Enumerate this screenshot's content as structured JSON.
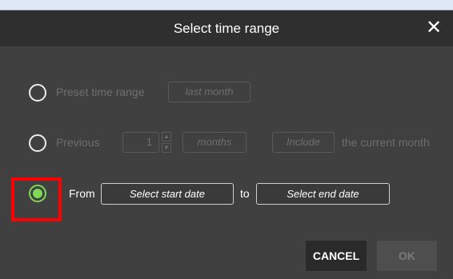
{
  "dialog": {
    "title": "Select time range",
    "close_symbol": "✕"
  },
  "options": {
    "preset": {
      "label": "Preset time range",
      "value": "last month"
    },
    "previous": {
      "label": "Previous",
      "count": "1",
      "unit": "months",
      "include": "Include",
      "suffix": "the current month"
    },
    "from": {
      "label": "From",
      "start_placeholder": "Select start date",
      "to_label": "to",
      "end_placeholder": "Select end date",
      "selected": true
    }
  },
  "buttons": {
    "cancel": "CANCEL",
    "ok": "OK"
  },
  "icons": {
    "close": "close-icon",
    "spin_up": "chevron-up-icon",
    "spin_down": "chevron-down-icon"
  },
  "colors": {
    "accent": "#7ed957",
    "highlight": "#ff0000",
    "header": "#2f2f2f",
    "body": "#404040"
  }
}
